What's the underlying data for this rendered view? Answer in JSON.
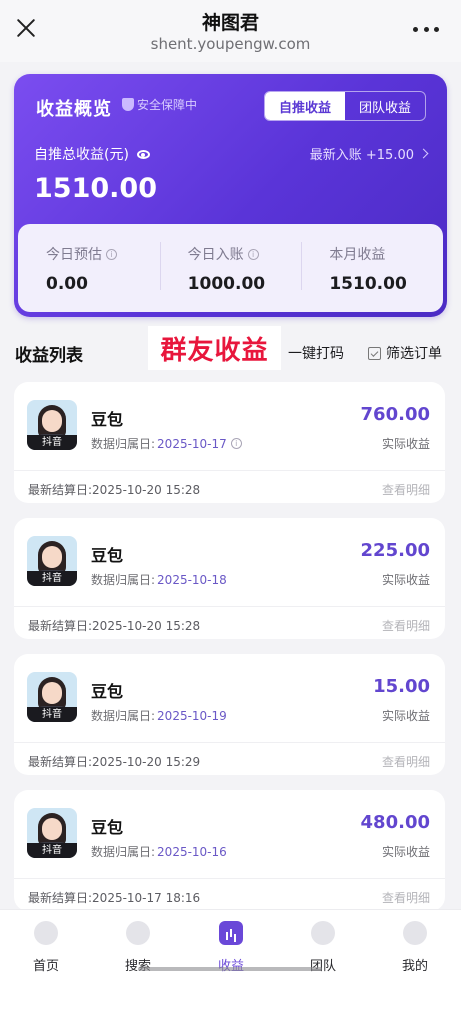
{
  "topbar": {
    "title": "神图君",
    "url": "shent.youpengw.com"
  },
  "card": {
    "title": "收益概览",
    "safe_badge": "安全保障中",
    "tabs": [
      "自推收益",
      "团队收益"
    ],
    "total_label": "自推总收益(元)",
    "latest_label": "最新入账 +15.00",
    "total_value": "1510.00",
    "stats": [
      {
        "label": "今日预估",
        "value": "0.00"
      },
      {
        "label": "今日入账",
        "value": "1000.00"
      },
      {
        "label": "本月收益",
        "value": "1510.00"
      }
    ]
  },
  "list": {
    "title": "收益列表",
    "overlay": "群友收益",
    "tap_code": "一键打码",
    "filter": "筛选订单",
    "records": [
      {
        "name": "豆包",
        "date_label": "数据归属日:",
        "date": "2025-10-17",
        "amount": "760.00",
        "amount_label": "实际收益",
        "settle": "最新结算日:2025-10-20 15:28",
        "detail": "查看明细",
        "tag": "抖音"
      },
      {
        "name": "豆包",
        "date_label": "数据归属日:",
        "date": "2025-10-18",
        "amount": "225.00",
        "amount_label": "实际收益",
        "settle": "最新结算日:2025-10-20 15:28",
        "detail": "查看明细",
        "tag": "抖音"
      },
      {
        "name": "豆包",
        "date_label": "数据归属日:",
        "date": "2025-10-19",
        "amount": "15.00",
        "amount_label": "实际收益",
        "settle": "最新结算日:2025-10-20 15:29",
        "detail": "查看明细",
        "tag": "抖音"
      },
      {
        "name": "豆包",
        "date_label": "数据归属日:",
        "date": "2025-10-16",
        "amount": "480.00",
        "amount_label": "实际收益",
        "settle": "最新结算日:2025-10-17 18:16",
        "detail": "查看明细",
        "tag": "抖音"
      }
    ]
  },
  "nav": [
    "首页",
    "搜索",
    "收益",
    "团队",
    "我的"
  ],
  "colors": {
    "accent": "#5b39d4",
    "overlay_red": "#e8163c"
  }
}
